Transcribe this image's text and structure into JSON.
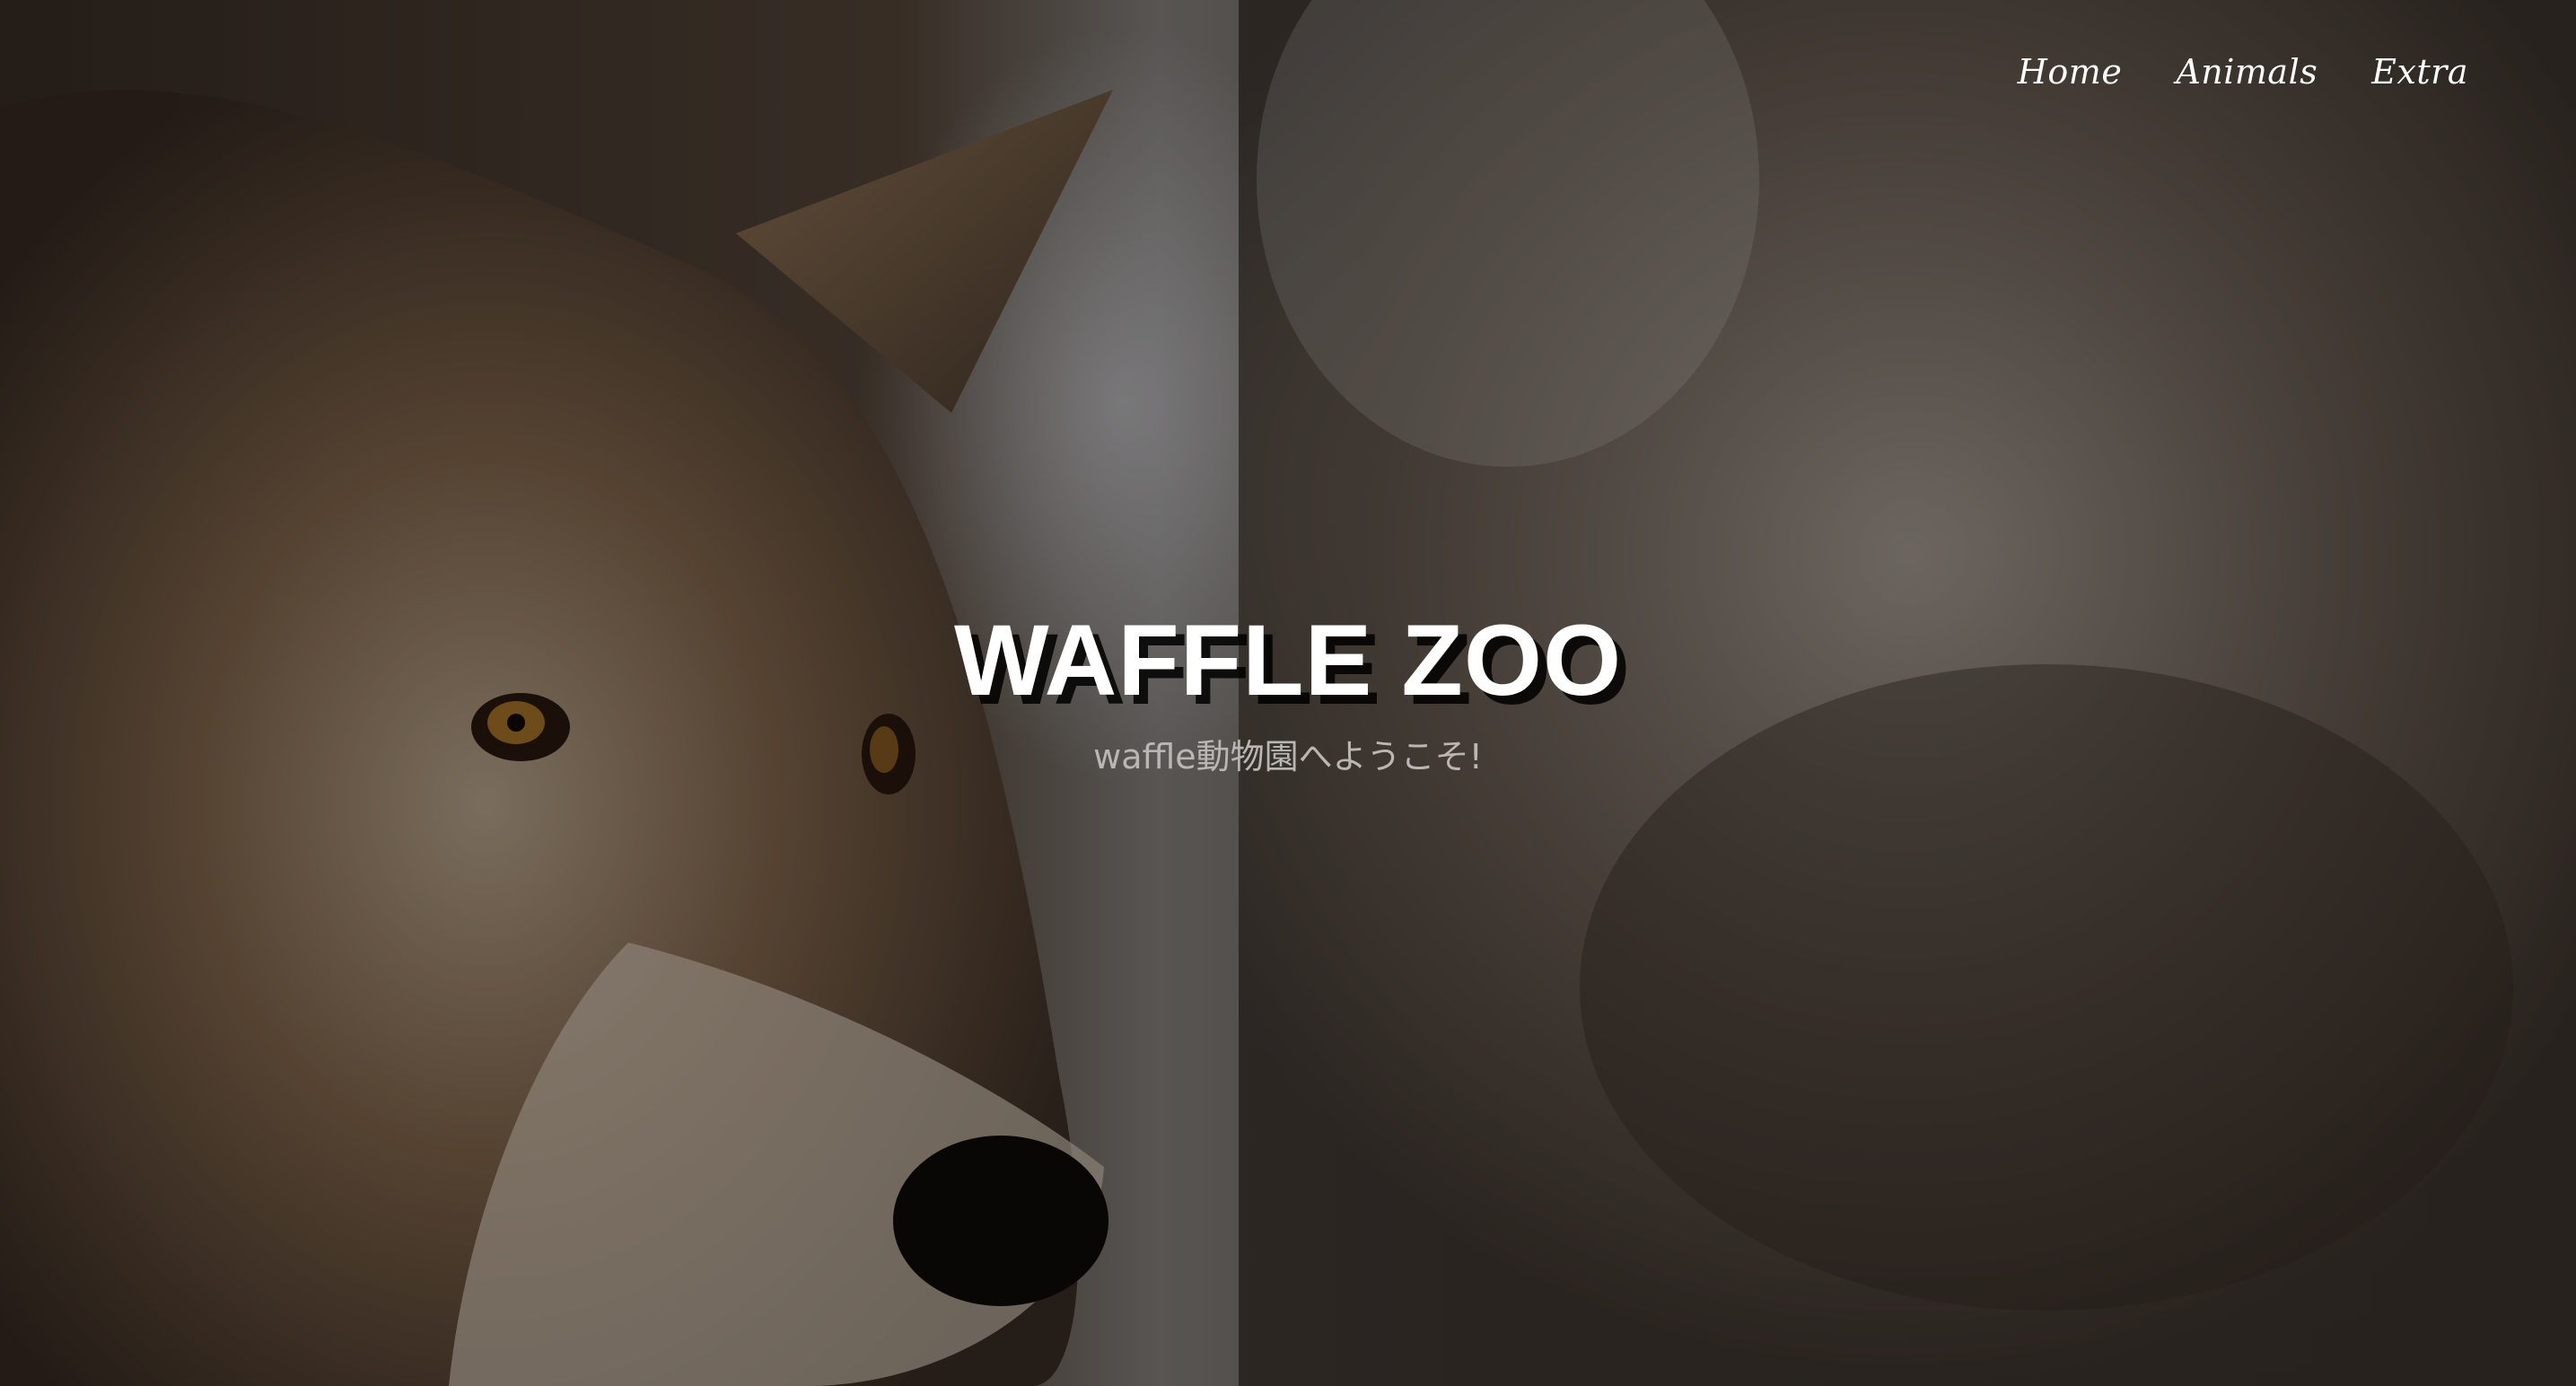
{
  "nav": {
    "items": [
      {
        "label": "Home"
      },
      {
        "label": "Animals"
      },
      {
        "label": "Extra"
      }
    ]
  },
  "hero": {
    "title": "WAFFLE ZOO",
    "subtitle": "waffle動物園へようこそ!",
    "background_image": "wolf-photo"
  },
  "colors": {
    "title": "#ffffff",
    "subtitle": "#b9b6b3",
    "nav_text": "#ffffff",
    "overlay": "rgba(0,0,0,0.38)"
  }
}
